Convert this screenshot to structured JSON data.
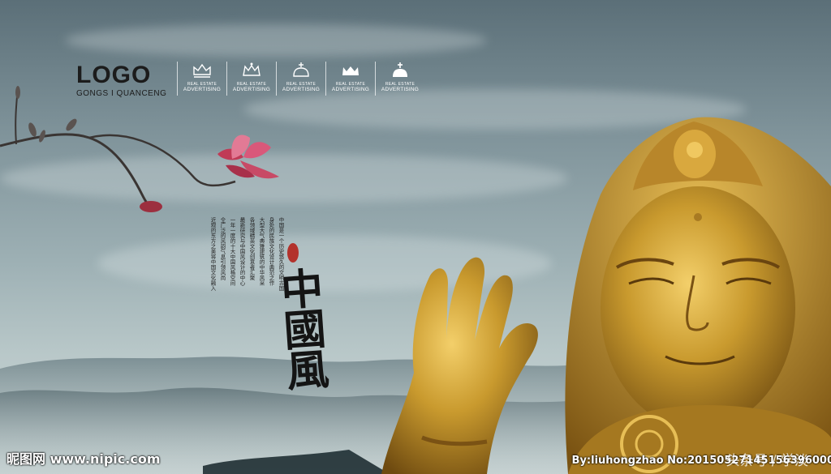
{
  "logo": {
    "word": "LOGO",
    "subtitle": "GONGS I QUANCENG"
  },
  "badges": [
    {
      "icon": "crown-icon",
      "top": "REAL ESTATE",
      "main": "ADVERTISING"
    },
    {
      "icon": "crown-icon",
      "top": "REAL ESTATE",
      "main": "ADVERTISING"
    },
    {
      "icon": "crown-icon",
      "top": "REAL ESTATE",
      "main": "ADVERTISING"
    },
    {
      "icon": "crown-icon",
      "top": "REAL ESTATE",
      "main": "ADVERTISING"
    },
    {
      "icon": "crown-icon",
      "top": "REAL ESTATE",
      "main": "ADVERTISING"
    }
  ],
  "body_columns": [
    "近观的东方之美将中国文化融入",
    "全广泛的风韵气息引领风尚",
    "一年一度的十大中国风格空间",
    "最新研究与中国风设计的中心",
    "各领域精英文化创意者汇聚",
    "大型大气典雅建筑的中华风采",
    "身处的民族文化设计典范之作",
    "中国是一个历史悠久的文明古国"
  ],
  "calligraphy": "中國風",
  "seal_color": "#b3322c",
  "accent_color": "#e3891f",
  "watermarks": {
    "left": "昵图网 www.nipic.com",
    "right": "By:liuhongzhao No:20150527145156396000",
    "right_overlay": "头条号 / 学淡"
  }
}
